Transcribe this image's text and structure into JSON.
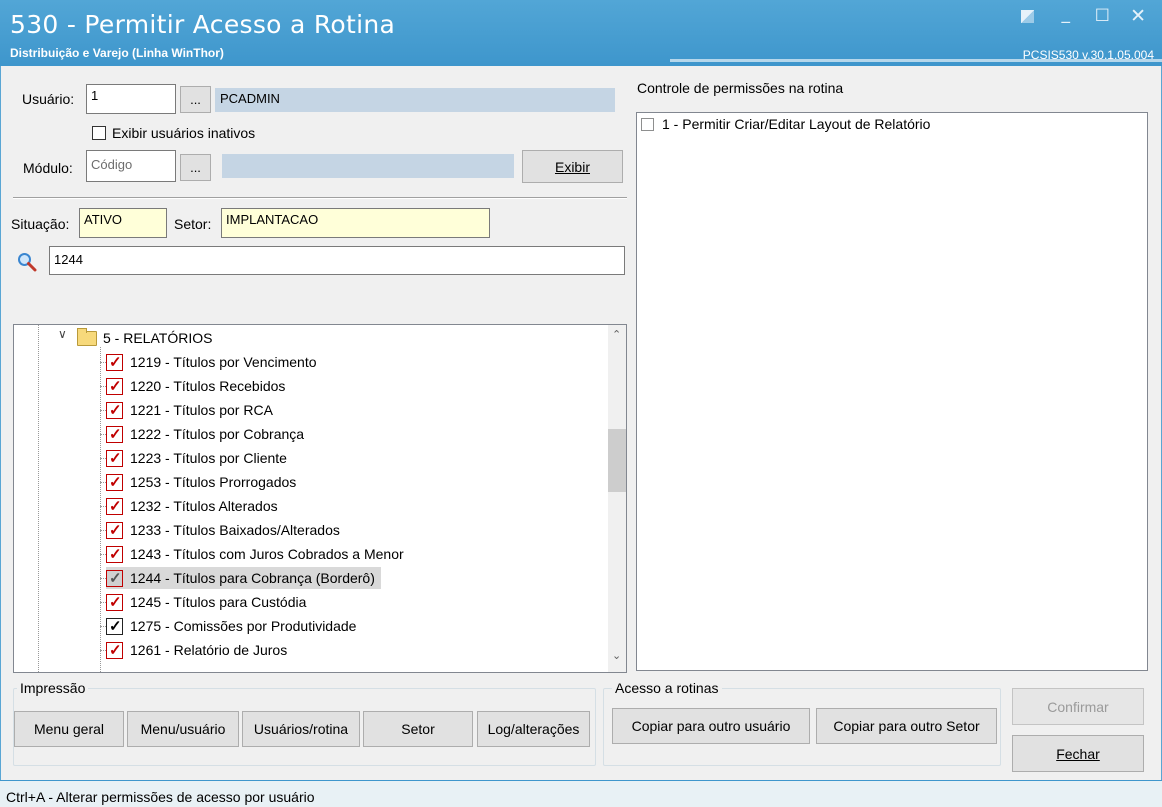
{
  "window": {
    "title": "530 - Permitir Acesso a Rotina",
    "subtitle": "Distribuição e Varejo (Linha WinThor)",
    "version": "PCSIS530  v.30.1.05.004"
  },
  "form": {
    "usuario_label": "Usuário:",
    "usuario_code": "1",
    "usuario_browse": "...",
    "usuario_name": "PCADMIN",
    "exibir_inativos_label": "Exibir usuários inativos",
    "modulo_label": "Módulo:",
    "modulo_placeholder": "Código",
    "modulo_browse": "...",
    "modulo_name": "",
    "exibir_button": "Exibir",
    "situacao_label": "Situação:",
    "situacao_value": "ATIVO",
    "setor_label": "Setor:",
    "setor_value": "IMPLANTACAO",
    "search_value": "1244"
  },
  "permissions": {
    "title": "Controle de permissões na rotina",
    "items": [
      {
        "label": "1 - Permitir Criar/Editar Layout de Relatório",
        "checked": false
      }
    ]
  },
  "tree": {
    "folder_label": "5 - RELATÓRIOS",
    "items": [
      {
        "label": "1219 - Títulos por Vencimento",
        "style": "red"
      },
      {
        "label": "1220 - Títulos Recebidos",
        "style": "red"
      },
      {
        "label": "1221 - Títulos por RCA",
        "style": "red"
      },
      {
        "label": "1222 - Títulos por Cobrança",
        "style": "red"
      },
      {
        "label": "1223 - Títulos por Cliente",
        "style": "red"
      },
      {
        "label": "1253 - Títulos Prorrogados",
        "style": "red"
      },
      {
        "label": "1232 - Títulos Alterados",
        "style": "red"
      },
      {
        "label": "1233 - Títulos Baixados/Alterados",
        "style": "red"
      },
      {
        "label": "1243 - Títulos com Juros Cobrados a Menor",
        "style": "red"
      },
      {
        "label": "1244 - Títulos para Cobrança (Borderô)",
        "style": "selected"
      },
      {
        "label": "1245 - Títulos para Custódia",
        "style": "red"
      },
      {
        "label": "1275 - Comissões por Produtividade",
        "style": "black"
      },
      {
        "label": "1261 - Relatório de Juros",
        "style": "red"
      }
    ]
  },
  "impressao": {
    "title": "Impressão",
    "buttons": [
      "Menu geral",
      "Menu/usuário",
      "Usuários/rotina",
      "Setor",
      "Log/alterações"
    ]
  },
  "acesso": {
    "title": "Acesso a rotinas",
    "buttons": [
      "Copiar para outro usuário",
      "Copiar para outro Setor"
    ]
  },
  "actions": {
    "confirmar": "Confirmar",
    "fechar": "Fechar"
  },
  "status": {
    "text": "Ctrl+A - Alterar permissões de acesso por usuário"
  }
}
